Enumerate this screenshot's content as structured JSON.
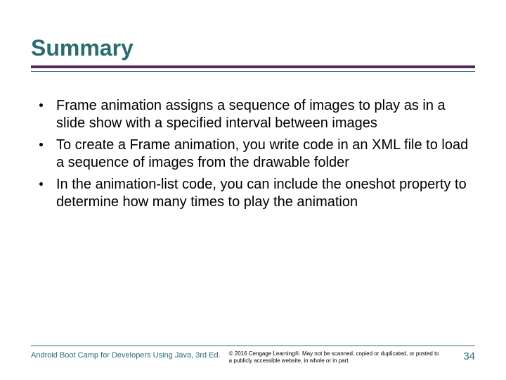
{
  "title": "Summary",
  "bullets": [
    "Frame animation assigns a sequence of images to play as in a slide show with a specified interval between images",
    "To create a Frame animation, you write code in an XML file to load a sequence of images from the drawable folder",
    "In the animation-list code, you can include the oneshot property to determine how many times to play the animation"
  ],
  "footer": {
    "left": "Android Boot Camp for Developers Using Java, 3rd Ed.",
    "mid": "© 2016 Cengage Learning®. May not be scanned, copied or duplicated, or posted to a publicly accessible website, in whole or in part.",
    "page": "34"
  }
}
